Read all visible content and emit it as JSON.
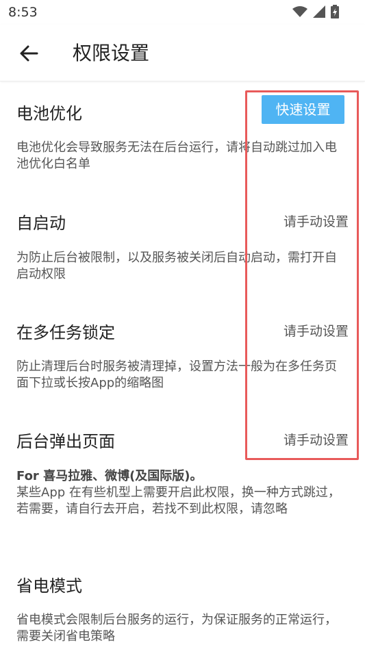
{
  "status": {
    "time": "8:53"
  },
  "header": {
    "title": "权限设置"
  },
  "sections": [
    {
      "title": "电池优化",
      "action": "快速设置",
      "desc": "电池优化会导致服务无法在后台运行，请将自动跳过加入电池优化白名单"
    },
    {
      "title": "自启动",
      "action": "请手动设置",
      "desc": "为防止后台被限制，以及服务被关闭后自动启动，需打开自启动权限"
    },
    {
      "title": "在多任务锁定",
      "action": "请手动设置",
      "desc": "防止清理后台时服务被清理掉，设置方法一般为在多任务页面下拉或长按App的缩略图"
    },
    {
      "title": "后台弹出页面",
      "action": "请手动设置",
      "note": "For 喜马拉雅、微博(及国际版)。",
      "desc": "某些App 在有些机型上需要开启此权限，换一种方式跳过，若需要，请自行去开启，若找不到此权限，请忽略"
    },
    {
      "title": "省电模式",
      "desc": "省电模式会限制后台服务的运行，为保证服务的正常运行，需要关闭省电策略"
    }
  ],
  "colors": {
    "accent": "#4fb4f3",
    "highlight": "#e85a5a"
  },
  "icons": {
    "back": "back-arrow-icon",
    "wifi": "wifi-icon",
    "signal": "signal-icon",
    "battery": "battery-charging-icon"
  }
}
